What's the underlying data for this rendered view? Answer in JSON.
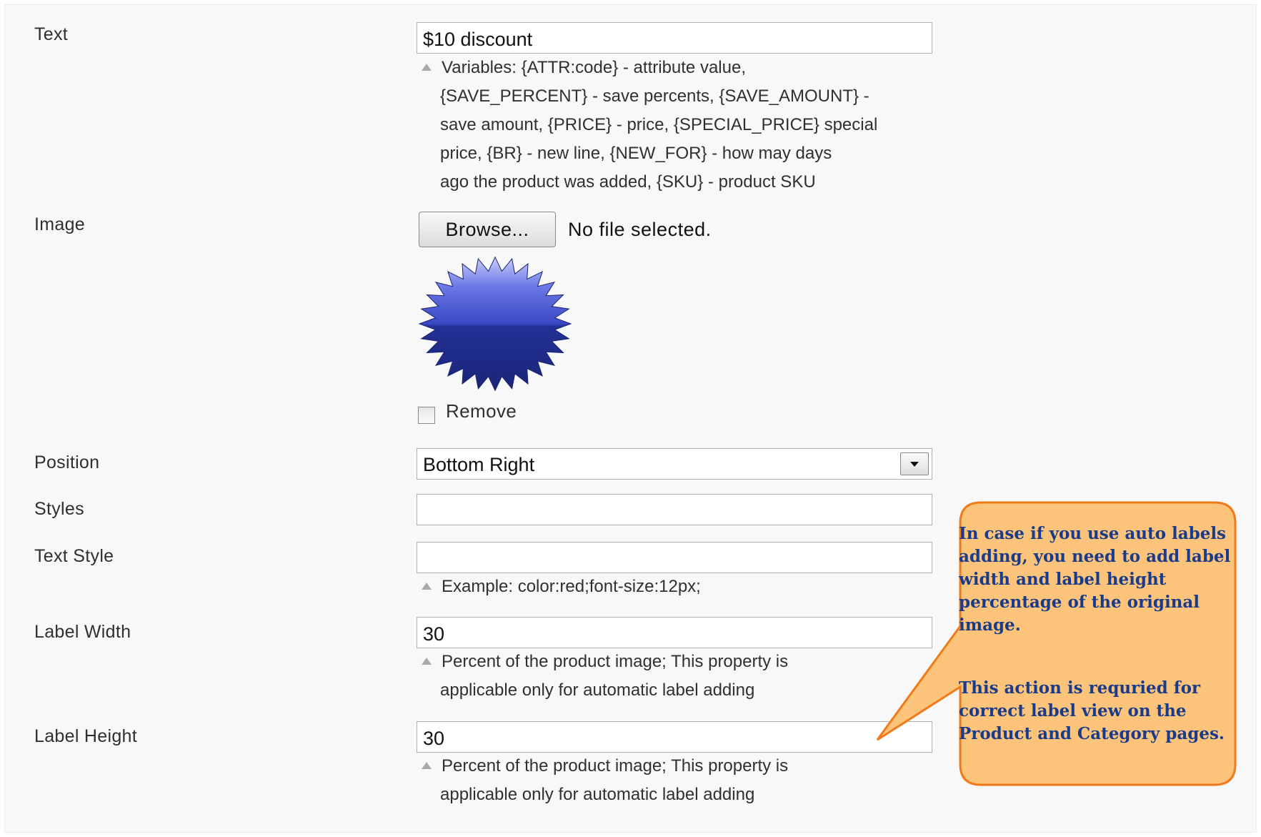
{
  "form": {
    "text": {
      "label": "Text",
      "value": "$10 discount",
      "note_lines": [
        "Variables: {ATTR:code} - attribute value,",
        "{SAVE_PERCENT} - save percents, {SAVE_AMOUNT} -",
        "save amount, {PRICE} - price, {SPECIAL_PRICE} special",
        "price, {BR} - new line, {NEW_FOR} - how may days",
        "ago the product was added, {SKU} - product SKU"
      ]
    },
    "image": {
      "label": "Image",
      "browse_label": "Browse...",
      "file_status": "No file selected.",
      "remove_label": "Remove",
      "preview_icon": "starburst-badge",
      "badge_color": "#2b3a9a"
    },
    "position": {
      "label": "Position",
      "selected": "Bottom Right"
    },
    "styles": {
      "label": "Styles",
      "value": ""
    },
    "text_style": {
      "label": "Text Style",
      "value": "",
      "note": "Example: color:red;font-size:12px;"
    },
    "label_width": {
      "label": "Label Width",
      "value": "30",
      "note_lines": [
        "Percent of the product image; This property is",
        "applicable only for automatic label adding"
      ]
    },
    "label_height": {
      "label": "Label Height",
      "value": "30",
      "note_lines": [
        "Percent of the product image; This property is",
        "applicable only for automatic label adding"
      ]
    }
  },
  "callout": {
    "paragraph_1": "In case if you use auto labels adding, you need to add label width and label height percentage of the original image.",
    "paragraph_2": "This action is requried for correct label view on the Product and Category pages.",
    "fill_color": "#fbc47a",
    "border_color": "#f07a1a",
    "text_color": "#1a3a8a"
  }
}
